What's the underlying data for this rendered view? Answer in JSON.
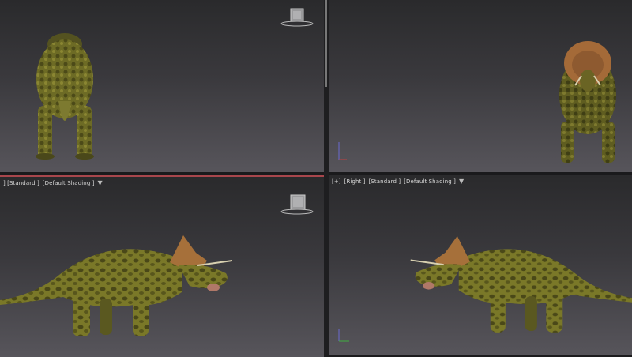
{
  "viewports": [
    {
      "id": "top-left",
      "label_parts": [],
      "view": "back"
    },
    {
      "id": "top-right",
      "label_parts": [],
      "view": "front"
    },
    {
      "id": "bottom-left",
      "label_parts": [
        "] [Standard ]",
        "[Default Shading ]"
      ],
      "filter_icon": "funnel-icon",
      "view": "side-left",
      "active": true
    },
    {
      "id": "bottom-right",
      "label_parts": [
        "[+]",
        "[Right ]",
        "[Standard ]",
        "[Default Shading ]"
      ],
      "filter_icon": "funnel-icon",
      "view": "side-right"
    }
  ],
  "colors": {
    "viewport_top": "#2a2a2c",
    "viewport_bottom": "#57555b",
    "active_border": "#a8464c",
    "dino_base": "#7a7a2a",
    "dino_spots": "#4a4a1a"
  },
  "icons": [
    "view-cube-icon",
    "axis-gizmo-icon",
    "funnel-icon"
  ]
}
